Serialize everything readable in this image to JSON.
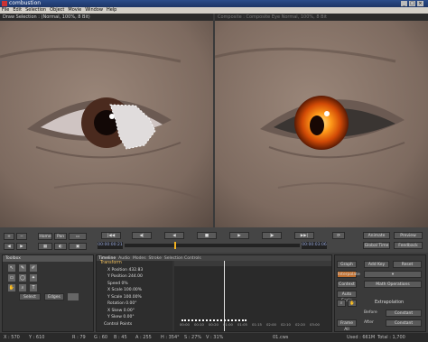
{
  "window": {
    "title": "combustion"
  },
  "menu": [
    "File",
    "Edit",
    "Selection",
    "Object",
    "Movie",
    "Window",
    "Help"
  ],
  "left_view": {
    "header": "Draw Selection :  (Normal, 100%, 8 Bit)"
  },
  "right_view": {
    "header": "Composite : Composite Eye Normal, 100%, 8 Bit"
  },
  "transport": {
    "timecode_current": "00:00:00:21",
    "timecode_end": "00:00:03:06"
  },
  "nav_buttons": [
    "Home",
    "Pan"
  ],
  "right_buttons": {
    "animate": "Animate",
    "preview": "Preview",
    "global_time": "Global Time",
    "feedback": "Feedback"
  },
  "toolbox": {
    "title": "Toolbox",
    "select": "Select",
    "edges": "Edges"
  },
  "timeline": {
    "tabs": [
      "Timeline",
      "Audio",
      "Modes",
      "Stroke",
      "Selection Controls"
    ],
    "header": "Transform",
    "properties": [
      "X Position  432.83",
      "Y Position  244.00",
      "Speed  0%",
      "X Scale  100.00%",
      "Y Scale  100.00%",
      "Rotation  0.00°",
      "X Skew  0.00°",
      "Y Skew  0.00°",
      "Control Points"
    ],
    "ruler": [
      "00:00",
      "00:10",
      "00:20",
      "01:00",
      "01:05",
      "01:15",
      "02:00",
      "02:10",
      "02:20",
      "03:00"
    ]
  },
  "right_panel": {
    "graph": "Graph",
    "add_key": "Add Key",
    "reset": "Reset",
    "interpolate": "Interpolate",
    "context": "Context",
    "math_ops": "Math Operations",
    "auto_scale": "Auto Scale",
    "extrapolation": "Extrapolation",
    "before": "Before",
    "after": "After",
    "constant": "Constant",
    "frame_all": "Frame All"
  },
  "status": {
    "x": "X : 570",
    "y": "Y : 610",
    "r": "R : 79",
    "g": "G : 60",
    "b": "B : 45",
    "a": "A : 255",
    "h": "H : 354°",
    "s": "S : 27%",
    "v": "V : 31%",
    "frame": "01.cws",
    "mem": "Used : 661M",
    "total": "Total : 1,700"
  }
}
